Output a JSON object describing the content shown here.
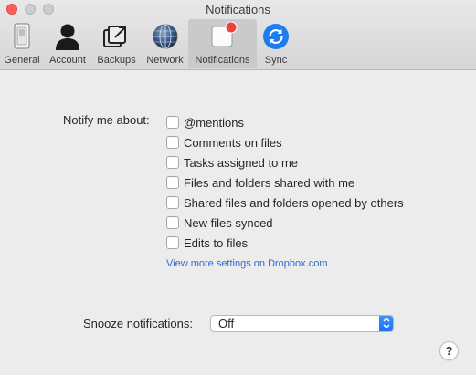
{
  "window": {
    "title": "Notifications"
  },
  "toolbar": {
    "items": [
      {
        "label": "General",
        "icon": "switch-icon",
        "selected": false
      },
      {
        "label": "Account",
        "icon": "person-icon",
        "selected": false
      },
      {
        "label": "Backups",
        "icon": "backup-icon",
        "selected": false
      },
      {
        "label": "Network",
        "icon": "globe-icon",
        "selected": false
      },
      {
        "label": "Notifications",
        "icon": "notification-badge-icon",
        "selected": true
      },
      {
        "label": "Sync",
        "icon": "sync-icon",
        "selected": false
      }
    ]
  },
  "notify": {
    "label": "Notify me about:",
    "options": [
      {
        "label": "@mentions",
        "checked": false
      },
      {
        "label": "Comments on files",
        "checked": false
      },
      {
        "label": "Tasks assigned to me",
        "checked": false
      },
      {
        "label": "Files and folders shared with me",
        "checked": false
      },
      {
        "label": "Shared files and folders opened by others",
        "checked": false
      },
      {
        "label": "New files synced",
        "checked": false
      },
      {
        "label": "Edits to files",
        "checked": false
      }
    ],
    "more_link": "View more settings on Dropbox.com"
  },
  "snooze": {
    "label": "Snooze notifications:",
    "value": "Off"
  },
  "help": {
    "label": "?"
  },
  "colors": {
    "accent": "#2d6ad3",
    "badge": "#f0413f",
    "sync_blue": "#1d7cf2",
    "close_button": "#fc605b"
  }
}
